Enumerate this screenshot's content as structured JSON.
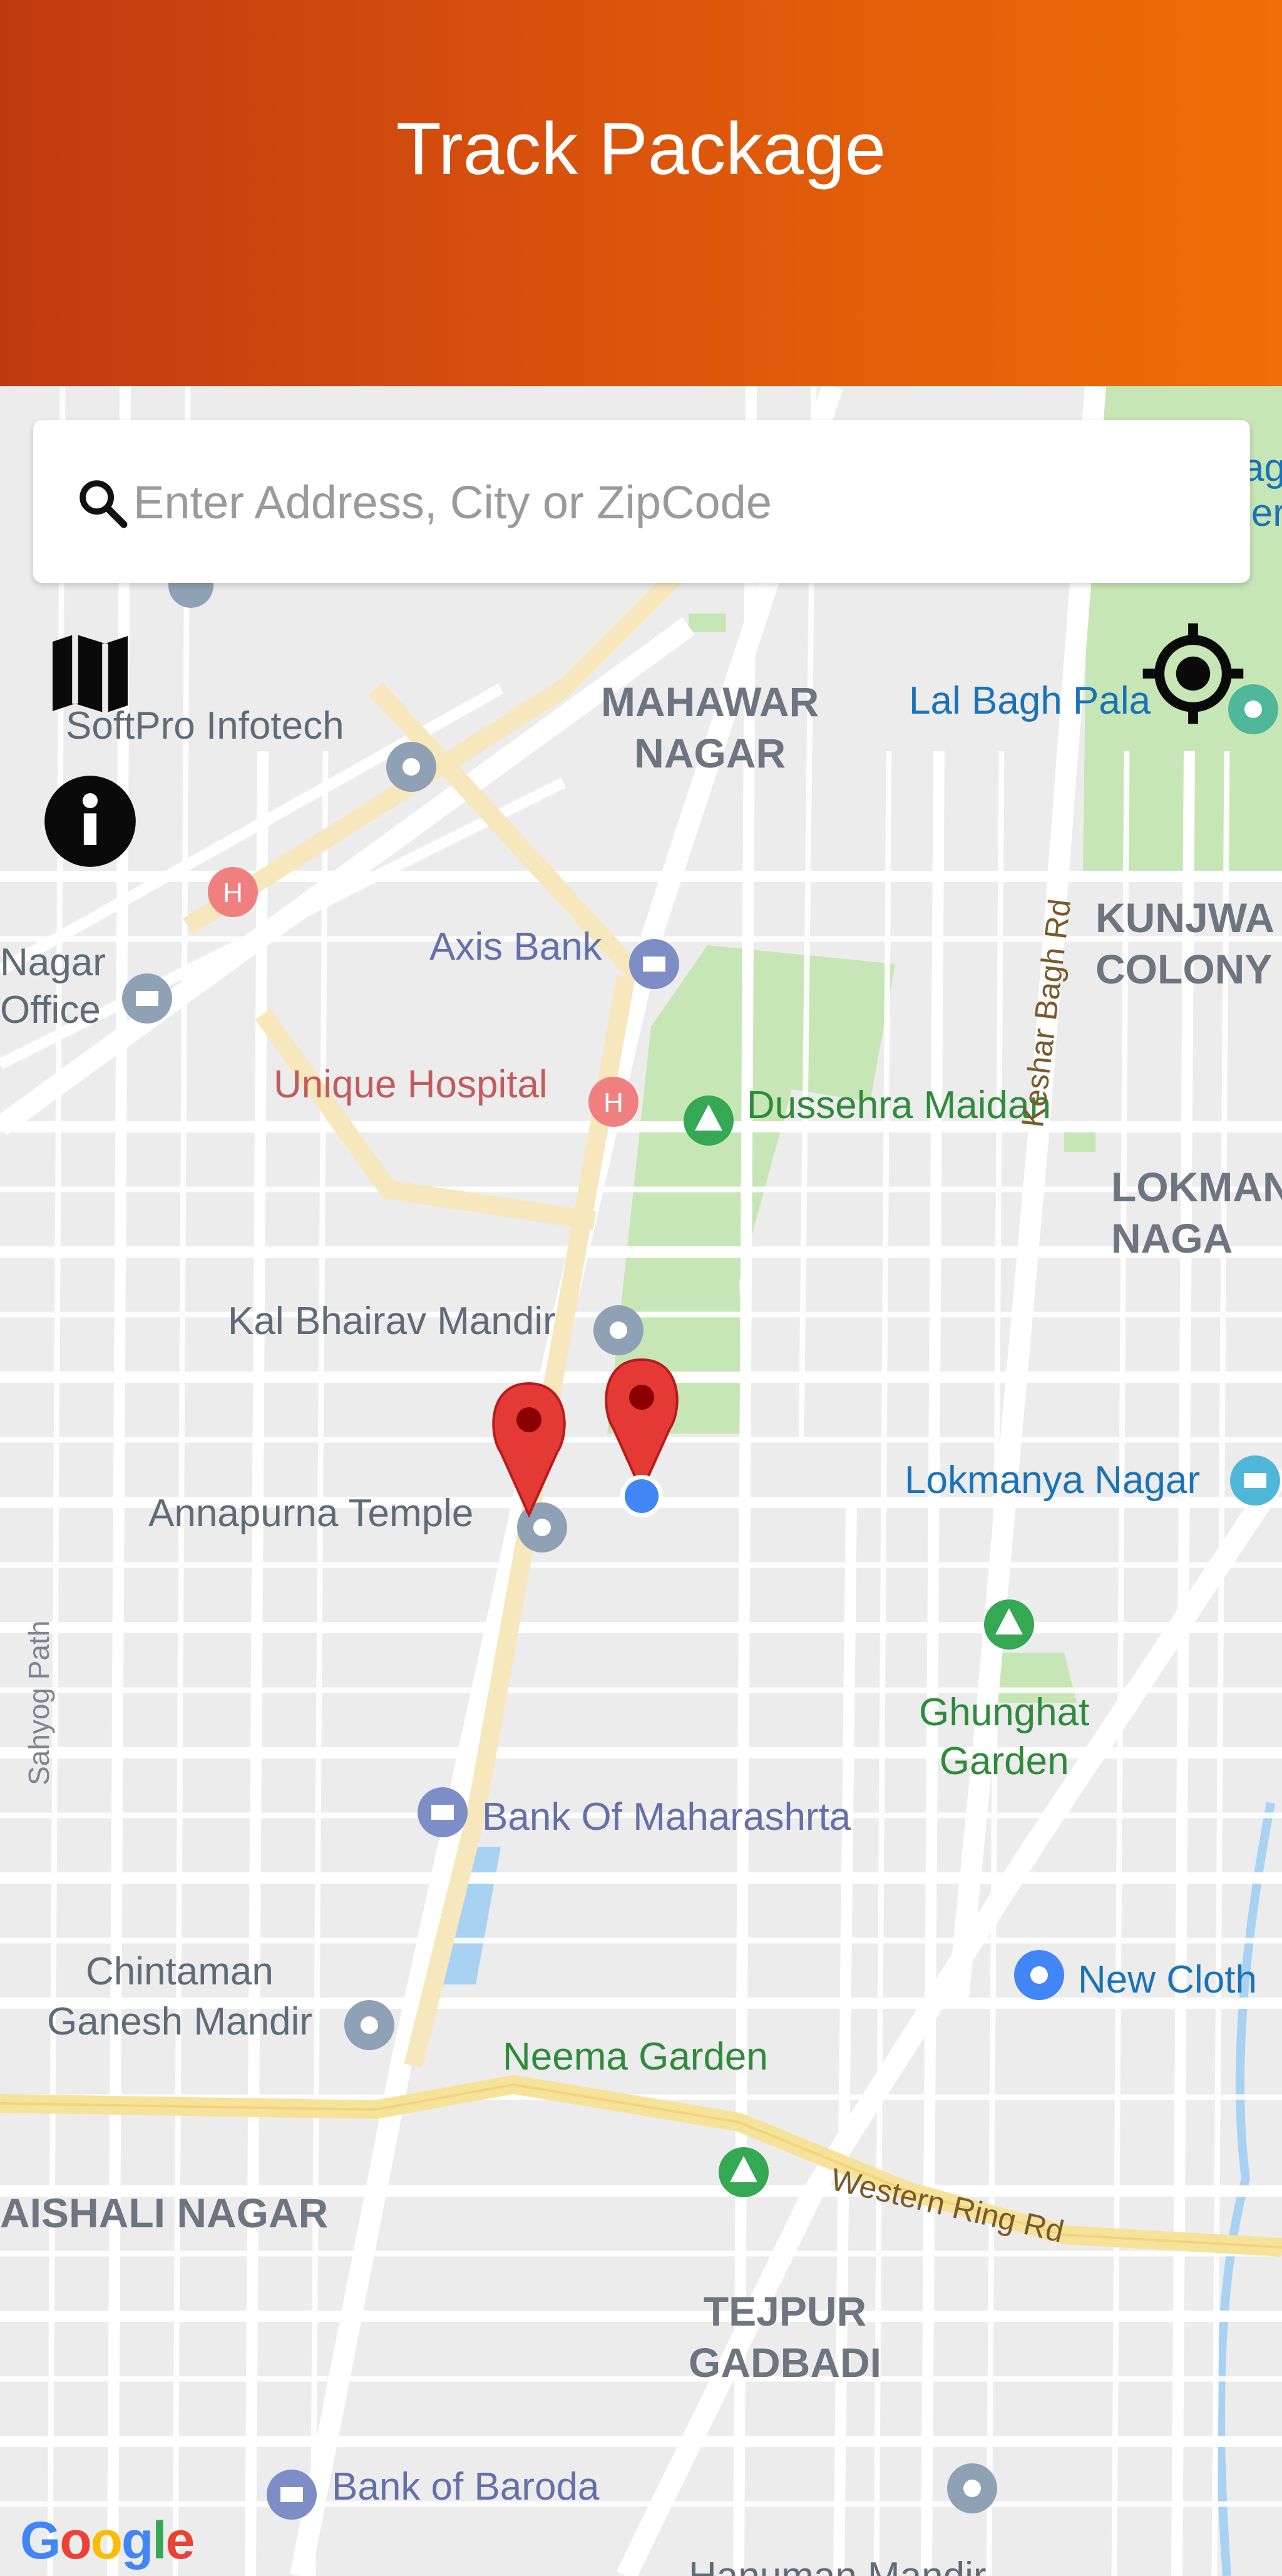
{
  "header": {
    "title": "Track Package"
  },
  "search": {
    "placeholder": "Enter Address, City or ZipCode",
    "value": ""
  },
  "map": {
    "attribution": [
      "G",
      "o",
      "o",
      "g",
      "l",
      "e"
    ],
    "areas": {
      "mahawar": "MAHAWAR\nNAGAR",
      "kunjwani": "KUNJWA\nCOLONY",
      "lokmanya_nagar_area": "LOKMAN\nNAGA",
      "vaishali": "AISHALI NAGAR",
      "tejpur": "TEJPUR\nGADBADI"
    },
    "places": {
      "softpro": "SoftPro Infotech",
      "lalbagh": "Lal Bagh Pala",
      "axis": "Axis Bank",
      "post_office": "Nagar\nOffice",
      "unique_hospital": "Unique Hospital",
      "dussehra": "Dussehra Maidan",
      "kal_bhairav": "Kal Bhairav Mandir",
      "annapurna": "Annapurna Temple",
      "lokmanya": "Lokmanya Nagar",
      "ghunghat": "Ghunghat\nGarden",
      "bank_maharashtra": "Bank Of Maharashrta",
      "chintaman": "Chintaman\nGanesh Mandir",
      "neema": "Neema Garden",
      "new_cloth": "New Cloth",
      "baroda": "Bank of Baroda",
      "hanuman": "Hanuman Mandir",
      "top_right_partial": "ag\nler"
    },
    "roads": {
      "keshar_bagh": "Keshar Bagh Rd",
      "sahyog": "Sahyog Path",
      "western_ring": "Western Ring Rd"
    }
  },
  "icons": {
    "search": "search-icon",
    "map": "map-icon",
    "info": "info-icon",
    "locate": "my-location-icon"
  },
  "colors": {
    "header_start": "#c03a10",
    "header_end": "#f06e05",
    "marker": "#e53935",
    "current_location": "#4285f4"
  }
}
